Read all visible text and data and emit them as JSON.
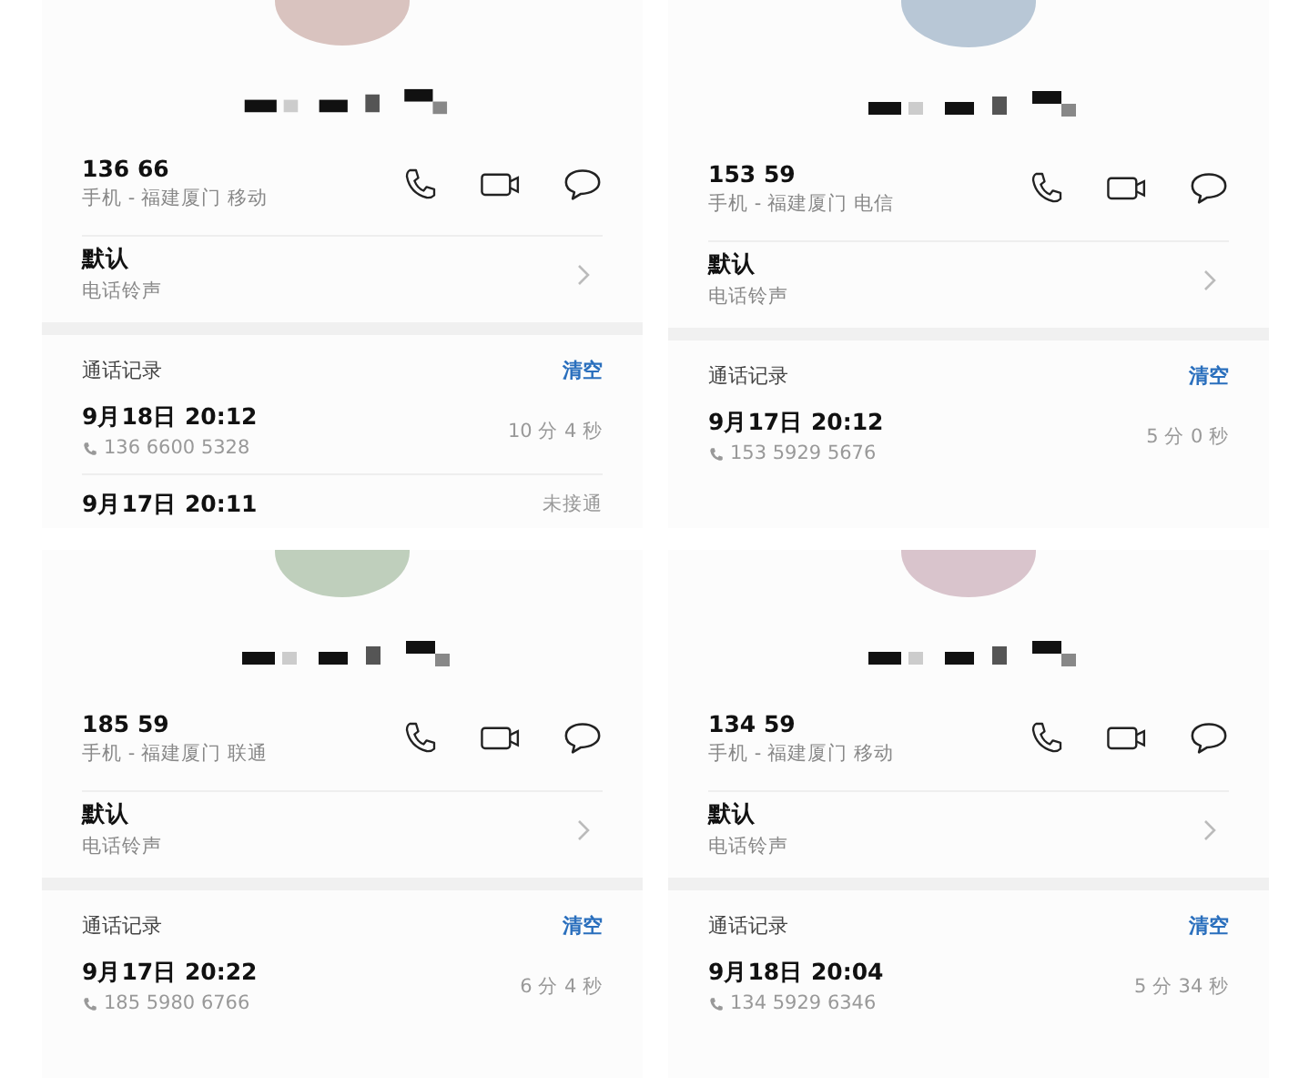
{
  "panels": [
    {
      "color": "#d9c3bf",
      "number": "136 66",
      "location": "手机 - 福建厦门 移动",
      "ringtone": {
        "value": "默认",
        "label": "电话铃声"
      },
      "log_title": "通话记录",
      "clear": "清空",
      "records": [
        {
          "date": "9月18日 20:12",
          "number": "136 6600 5328",
          "duration": "10 分 4 秒"
        },
        {
          "date": "9月17日 20:11",
          "duration": "未接通"
        }
      ]
    },
    {
      "color": "#b8c7d6",
      "number": "153 59",
      "location": "手机 - 福建厦门 电信",
      "ringtone": {
        "value": "默认",
        "label": "电话铃声"
      },
      "log_title": "通话记录",
      "clear": "清空",
      "records": [
        {
          "date": "9月17日 20:12",
          "number": "153 5929 5676",
          "duration": "5 分 0 秒"
        }
      ]
    },
    {
      "color": "#bfcfbc",
      "number": "185 59",
      "location": "手机 - 福建厦门 联通",
      "ringtone": {
        "value": "默认",
        "label": "电话铃声"
      },
      "log_title": "通话记录",
      "clear": "清空",
      "records": [
        {
          "date": "9月17日 20:22",
          "number": "185 5980 6766",
          "duration": "6 分 4 秒"
        }
      ]
    },
    {
      "color": "#d9c4cc",
      "number": "134 59",
      "location": "手机 - 福建厦门 移动",
      "ringtone": {
        "value": "默认",
        "label": "电话铃声"
      },
      "log_title": "通话记录",
      "clear": "清空",
      "records": [
        {
          "date": "9月18日 20:04",
          "number": "134 5929 6346",
          "duration": "5 分 34 秒"
        }
      ]
    }
  ]
}
